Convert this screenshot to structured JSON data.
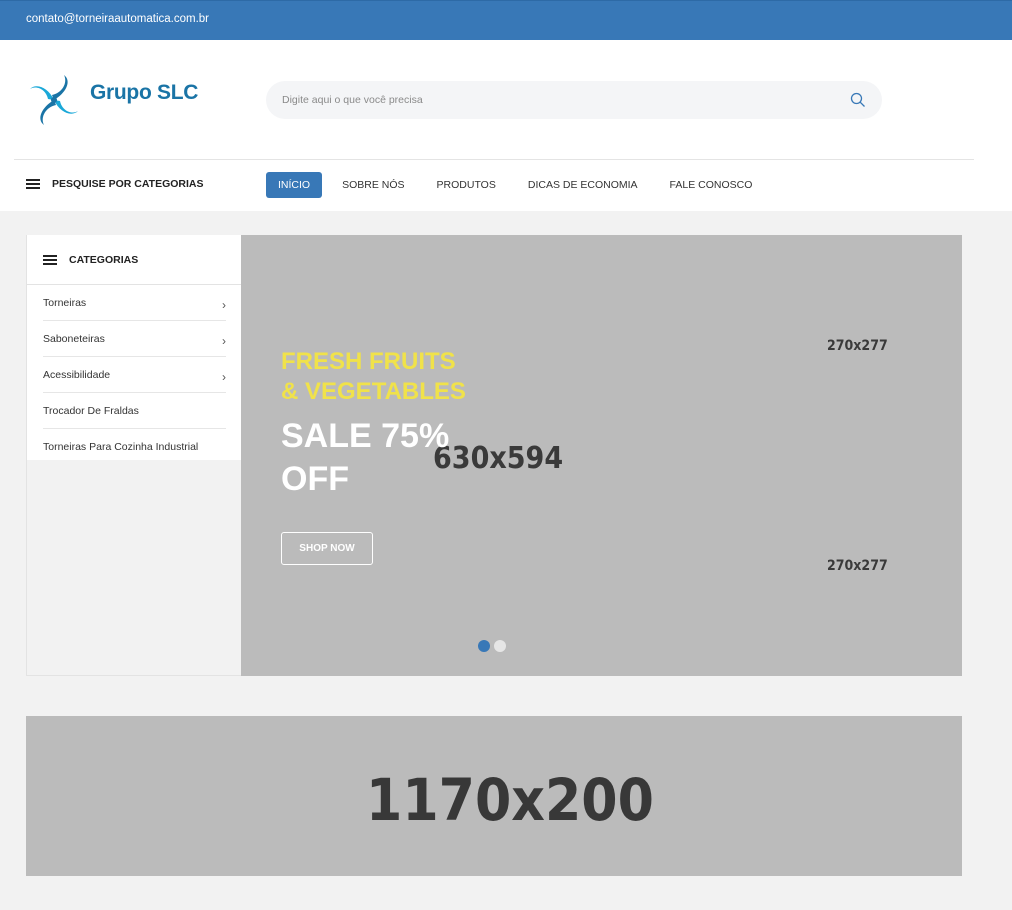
{
  "topbar": {
    "email": "contato@torneiraautomatica.com.br"
  },
  "header": {
    "brand": "Grupo SLC",
    "search": {
      "placeholder": "Digite aqui o que você precisa"
    }
  },
  "nav": {
    "categories_button": "PESQUISE POR CATEGORIAS",
    "items": [
      {
        "label": "INÍCIO",
        "active": true
      },
      {
        "label": "SOBRE NÓS"
      },
      {
        "label": "PRODUTOS"
      },
      {
        "label": "DICAS DE ECONOMIA"
      },
      {
        "label": "FALE CONOSCO"
      }
    ]
  },
  "sidebar": {
    "title": "CATEGORIAS",
    "items": [
      {
        "label": "Torneiras",
        "has_children": true
      },
      {
        "label": "Saboneteiras",
        "has_children": true
      },
      {
        "label": "Acessibilidade",
        "has_children": true
      },
      {
        "label": "Trocador De Fraldas",
        "has_children": false
      },
      {
        "label": "Torneiras Para Cozinha Industrial",
        "has_children": false
      }
    ]
  },
  "hero": {
    "subtitle_line1": "FRESH FRUITS",
    "subtitle_line2": "& VEGETABLES",
    "headline_line1": "SALE 75%",
    "headline_line2": "OFF",
    "button": "SHOP NOW",
    "placeholder_main": "630x594",
    "placeholder_top": "270x277",
    "placeholder_bottom": "270x277",
    "slides": 2,
    "active_slide": 1
  },
  "banner": {
    "placeholder": "1170x200"
  },
  "colors": {
    "primary": "#3878b7",
    "accent_yellow": "#f0e24a",
    "placeholder_gray": "#bbbbbb"
  }
}
